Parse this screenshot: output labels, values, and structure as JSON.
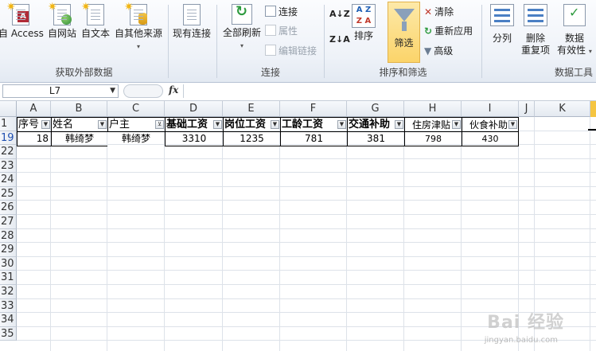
{
  "ribbon": {
    "get_external": {
      "label": "获取外部数据",
      "buttons": [
        "自 Access",
        "自网站",
        "自文本",
        "自其他来源"
      ]
    },
    "existing_connections": "现有连接",
    "connections": {
      "label": "连接",
      "refresh_all": "全部刷新",
      "connect": "连接",
      "properties": "属性",
      "edit_links": "编辑链接"
    },
    "sort_filter": {
      "label": "排序和筛选",
      "sort_az": "A↓Z",
      "sort_za": "Z↓A",
      "sort": "排序",
      "filter": "筛选",
      "clear": "清除",
      "reapply": "重新应用",
      "advanced": "高级"
    },
    "data_tools": {
      "label": "数据工具",
      "text_to_columns": "分列",
      "remove_duplicates_1": "删除",
      "remove_duplicates_2": "重复项",
      "validation_1": "数据",
      "validation_2": "有效性"
    }
  },
  "formula_bar": {
    "name_box": "L7",
    "fx": "fx",
    "formula": ""
  },
  "columns": [
    "A",
    "B",
    "C",
    "D",
    "E",
    "F",
    "G",
    "H",
    "I",
    "J",
    "K"
  ],
  "header_row": {
    "row_num": "1",
    "cells": [
      "序号",
      "姓名",
      "户主",
      "基础工资",
      "岗位工资",
      "工龄工资",
      "交通补助",
      "住房津贴",
      "伙食补助"
    ]
  },
  "data_row": {
    "row_num": "19",
    "cells": [
      "18",
      "韩绮梦",
      "韩绮梦",
      "3310",
      "1235",
      "781",
      "381",
      "798",
      "430"
    ]
  },
  "empty_rows": [
    "22",
    "23",
    "24",
    "25",
    "26",
    "27",
    "28",
    "29",
    "30",
    "31",
    "32",
    "33",
    "34",
    "35"
  ],
  "watermark": {
    "main": "Bai 经验",
    "sub": "jingyan.baidu.com"
  }
}
